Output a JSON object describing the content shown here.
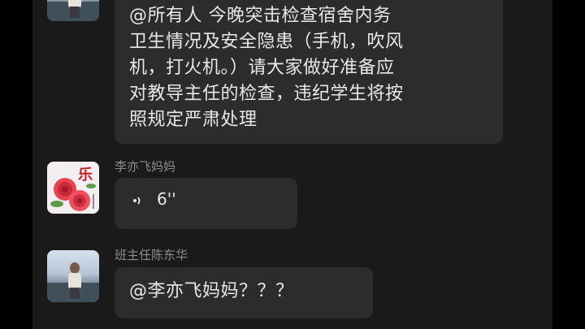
{
  "messages": [
    {
      "sender": "",
      "type": "text",
      "text": "@所有人 今晚突击检查宿舍内务\n卫生情况及安全隐患（手机，吹风\n机，打火机。）请大家做好准备应\n对教导主任的检查，违纪学生将按\n照规定严肃处理"
    },
    {
      "sender": "李亦飞妈妈",
      "type": "voice",
      "duration": "6''",
      "avatar_text": "乐"
    },
    {
      "sender": "班主任陈东华",
      "type": "text",
      "text": "@李亦飞妈妈？？？"
    }
  ],
  "colors": {
    "background": "#1a1a1a",
    "bubble": "#2c2c2c",
    "text": "#e8e8e8",
    "sender": "#8d8d8d"
  },
  "icons": [
    "voice-icon",
    "avatar-photo",
    "avatar-roses"
  ]
}
